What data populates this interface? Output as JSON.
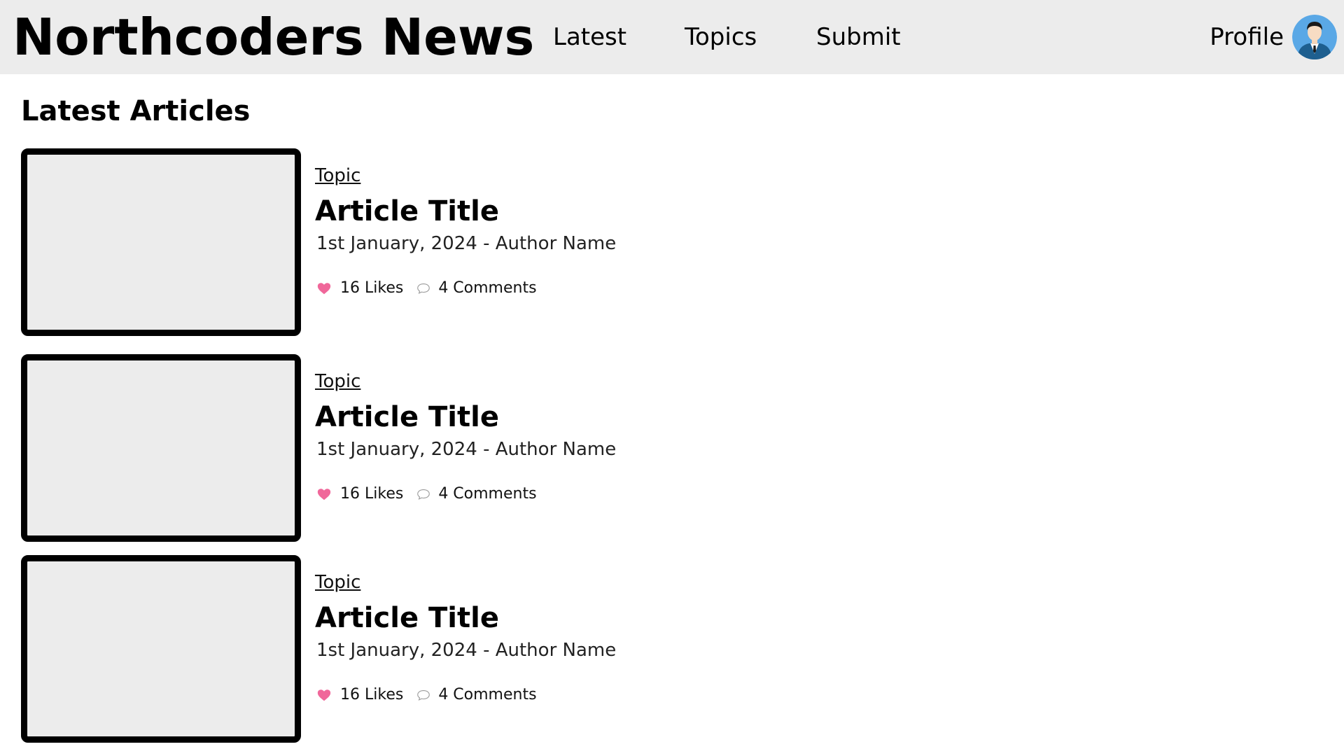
{
  "header": {
    "brand": "Northcoders News",
    "nav": {
      "latest": "Latest",
      "topics": "Topics",
      "submit": "Submit"
    },
    "profile_label": "Profile"
  },
  "main": {
    "heading": "Latest Articles",
    "articles": [
      {
        "topic": "Topic",
        "title": "Article Title",
        "byline": "1st January, 2024 - Author Name",
        "likes": "16 Likes",
        "comments": "4 Comments"
      },
      {
        "topic": "Topic",
        "title": "Article Title",
        "byline": "1st January, 2024 - Author Name",
        "likes": "16 Likes",
        "comments": "4 Comments"
      },
      {
        "topic": "Topic",
        "title": "Article Title",
        "byline": "1st January, 2024 - Author Name",
        "likes": "16 Likes",
        "comments": "4 Comments"
      }
    ]
  },
  "colors": {
    "header_background": "#ececec",
    "thumbnail_background": "#ececec",
    "thumbnail_border": "#000000",
    "like_heart": "#f0679a",
    "avatar_background": "#5aa8e6"
  },
  "icons": {
    "avatar": "user-avatar-icon",
    "like": "heart-icon",
    "comment": "speech-bubble-icon"
  }
}
